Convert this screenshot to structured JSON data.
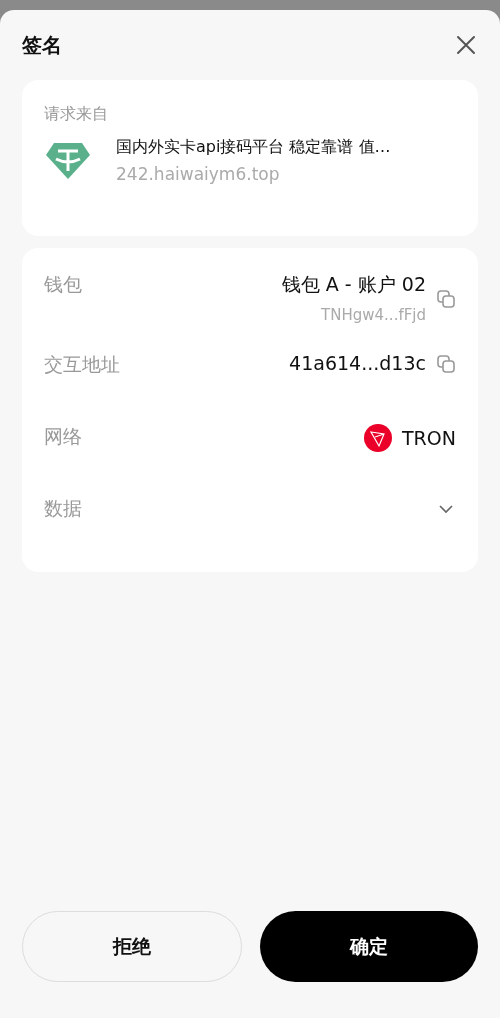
{
  "title": "签名",
  "request": {
    "label": "请求来自",
    "site_name": "国内外实卡api接码平台 稳定靠谱 值…",
    "site_url": "242.haiwaiym6.top"
  },
  "details": [
    {
      "kind": "wallet",
      "label": "钱包",
      "value": "钱包 A - 账户 02",
      "sub": "TNHgw4...fFjd"
    },
    {
      "kind": "address",
      "label": "交互地址",
      "value": "41a614...d13c"
    },
    {
      "kind": "network",
      "label": "网络",
      "value": "TRON"
    },
    {
      "kind": "expand",
      "label": "数据",
      "expanded": false
    }
  ],
  "buttons": [
    {
      "label": "拒绝",
      "kind": "secondary"
    },
    {
      "label": "确定",
      "kind": "primary"
    }
  ]
}
